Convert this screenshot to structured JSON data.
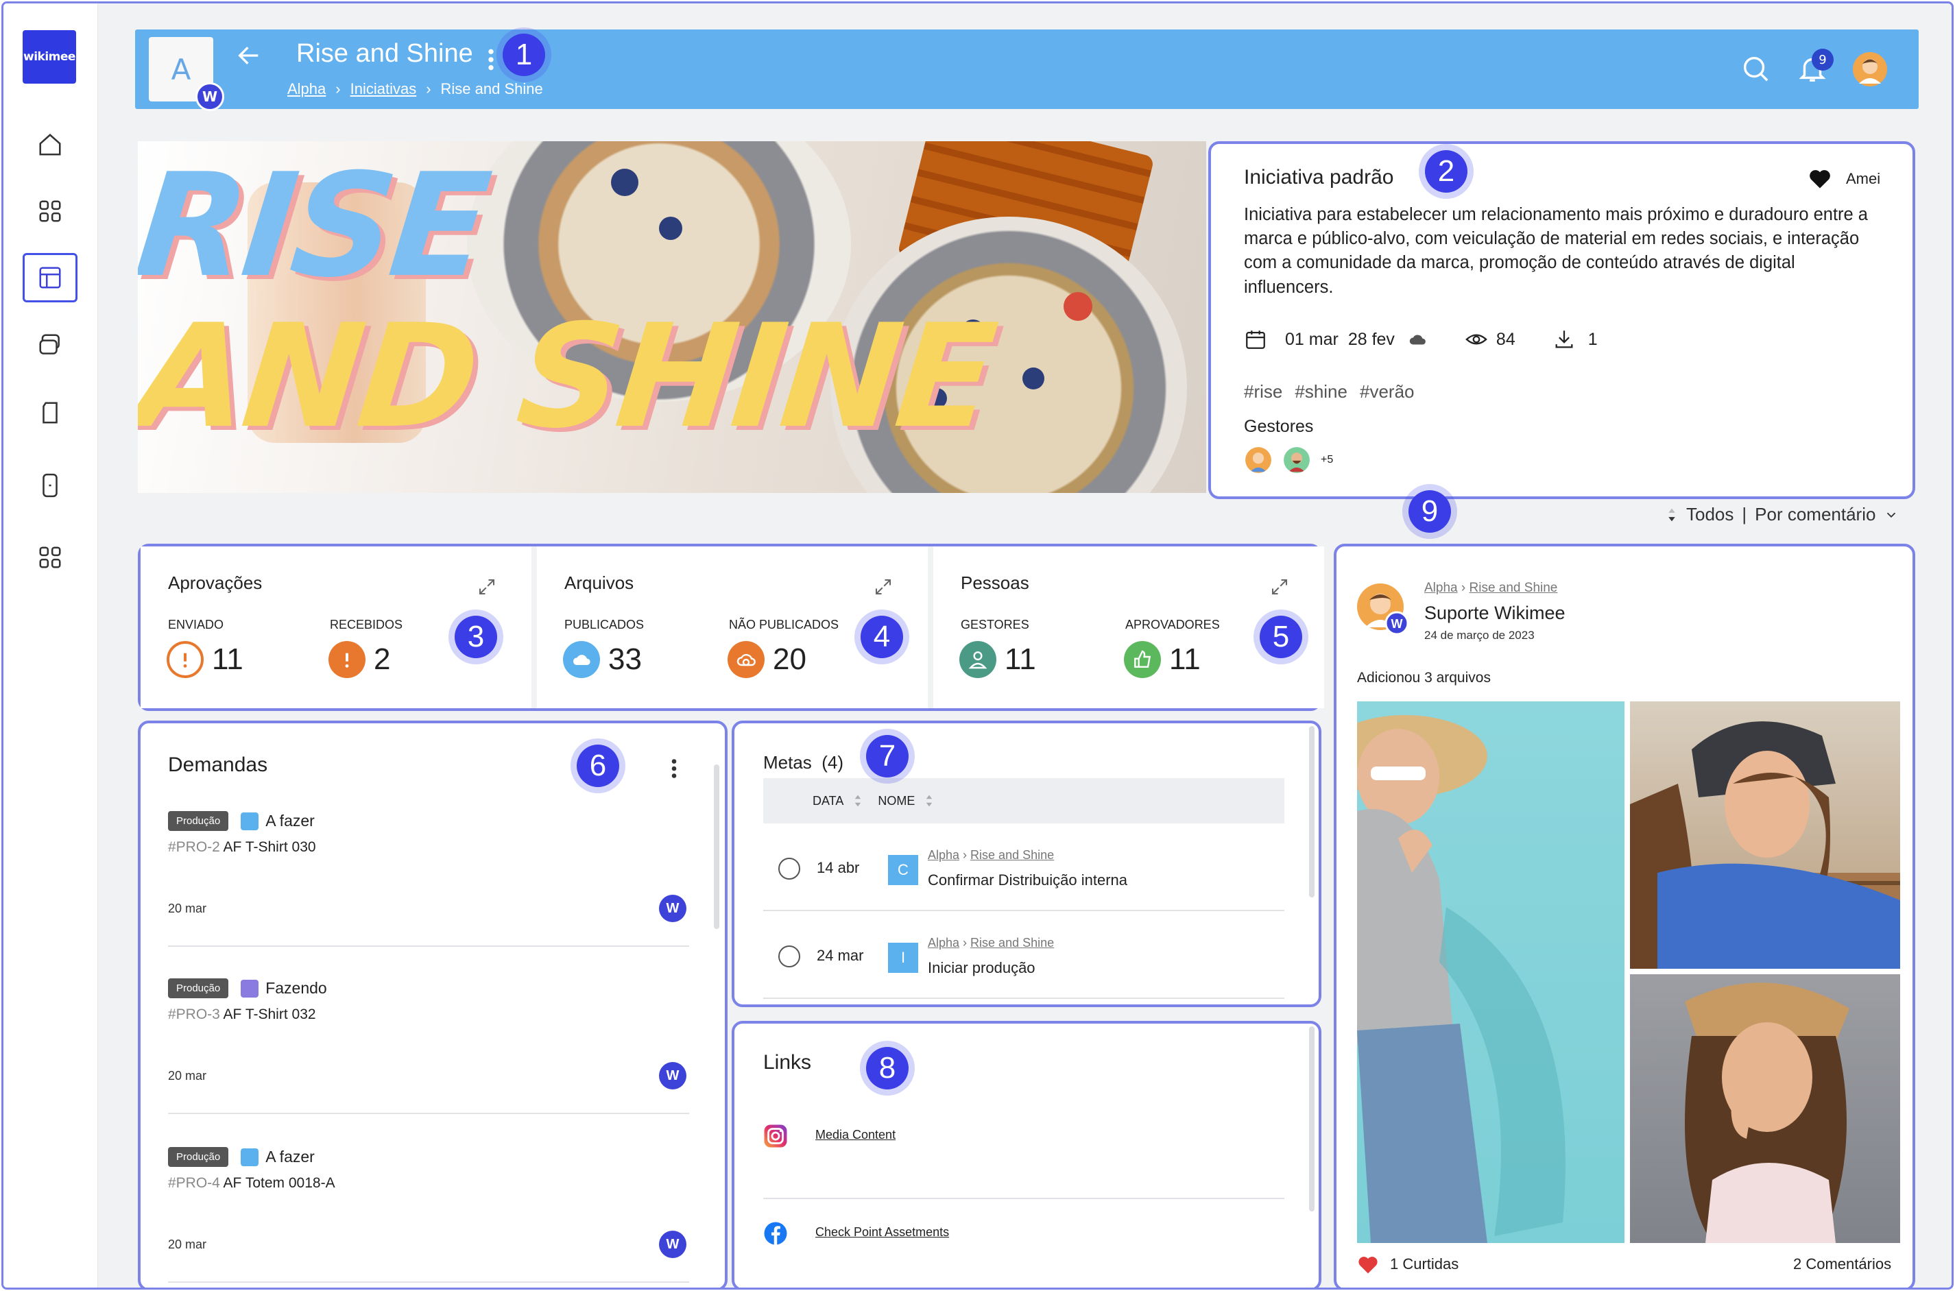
{
  "app": {
    "logo_text": "wikimee"
  },
  "header": {
    "avatar_letter": "A",
    "badge_letter": "W",
    "title": "Rise and Shine",
    "breadcrumb": [
      {
        "label": "Alpha",
        "link": true
      },
      {
        "label": "Iniciativas",
        "link": true
      },
      {
        "label": "Rise and Shine",
        "link": false
      }
    ],
    "notifications_count": "9",
    "accent_color": "#63b0ef"
  },
  "sidebar": {
    "items": [
      {
        "icon": "home-icon"
      },
      {
        "icon": "grid-icon"
      },
      {
        "icon": "layout-icon",
        "active": true
      },
      {
        "icon": "cards-icon"
      },
      {
        "icon": "document-icon"
      },
      {
        "icon": "device-icon"
      },
      {
        "icon": "apps-icon"
      }
    ]
  },
  "hero": {
    "line1": "RISE",
    "line2": "AND SHINE"
  },
  "markers": [
    "1",
    "2",
    "3",
    "4",
    "5",
    "6",
    "7",
    "8",
    "9"
  ],
  "info": {
    "title": "Iniciativa padrão",
    "like_label": "Amei",
    "description": "Iniciativa para estabelecer um relacionamento mais próximo e duradouro entre a marca e público-alvo, com veiculação de material em redes sociais, e interação com a comunidade da marca, promoção de conteúdo através de digital influencers.",
    "start_date": "01 mar",
    "end_date": "28 fev",
    "views": "84",
    "downloads": "1",
    "tags": [
      "#rise",
      "#shine",
      "#verão"
    ],
    "managers_label": "Gestores",
    "managers_more": "+5"
  },
  "filter": {
    "all": "Todos",
    "separator": "|",
    "sort": "Por comentário"
  },
  "stats": [
    {
      "title": "Aprovações",
      "items": [
        {
          "label": "ENVIADO",
          "value": "11",
          "color": "#e8782d",
          "style": "outline",
          "icon": "alert-icon"
        },
        {
          "label": "RECEBIDOS",
          "value": "2",
          "color": "#e8782d",
          "style": "filled",
          "icon": "alert-icon"
        }
      ]
    },
    {
      "title": "Arquivos",
      "items": [
        {
          "label": "PUBLICADOS",
          "value": "33",
          "color": "#5bb1ee",
          "style": "filled",
          "icon": "cloud-icon"
        },
        {
          "label": "NÃO PUBLICADOS",
          "value": "20",
          "color": "#e8782d",
          "style": "filled",
          "icon": "cloud-off-icon"
        }
      ]
    },
    {
      "title": "Pessoas",
      "items": [
        {
          "label": "GESTORES",
          "value": "11",
          "color": "#4b9a86",
          "style": "filled",
          "icon": "user-icon"
        },
        {
          "label": "APROVADORES",
          "value": "11",
          "color": "#5cb85c",
          "style": "filled",
          "icon": "thumbs-up-icon"
        }
      ]
    }
  ],
  "demands": {
    "title": "Demandas",
    "items": [
      {
        "tag": "Produção",
        "status": "A fazer",
        "status_color": "#5bb1ee",
        "id": "#PRO-2",
        "name": "AF T-Shirt 030",
        "date": "20 mar",
        "assignee": "W"
      },
      {
        "tag": "Produção",
        "status": "Fazendo",
        "status_color": "#8a7be0",
        "id": "#PRO-3",
        "name": "AF T-Shirt 032",
        "date": "20 mar",
        "assignee": "W"
      },
      {
        "tag": "Produção",
        "status": "A fazer",
        "status_color": "#5bb1ee",
        "id": "#PRO-4",
        "name": "AF Totem 0018-A",
        "date": "20 mar",
        "assignee": "W"
      }
    ]
  },
  "goals": {
    "title": "Metas",
    "count": "(4)",
    "col_date": "DATA",
    "col_name": "NOME",
    "rows": [
      {
        "date": "14 abr",
        "letter": "C",
        "crumb1": "Alpha",
        "crumb2": "Rise and Shine",
        "name": "Confirmar Distribuição interna"
      },
      {
        "date": "24 mar",
        "letter": "I",
        "crumb1": "Alpha",
        "crumb2": "Rise and Shine",
        "name": "Iniciar produção"
      }
    ]
  },
  "links": {
    "title": "Links",
    "items": [
      {
        "icon": "instagram-icon",
        "label": "Media Content"
      },
      {
        "icon": "facebook-icon",
        "label": "Check Point Assetments"
      }
    ]
  },
  "feed": {
    "crumb1": "Alpha",
    "crumb2": "Rise and Shine",
    "author": "Suporte Wikimee",
    "date": "24 de março de 2023",
    "text": "Adicionou 3 arquivos",
    "likes": "1 Curtidas",
    "comments": "2 Comentários"
  }
}
